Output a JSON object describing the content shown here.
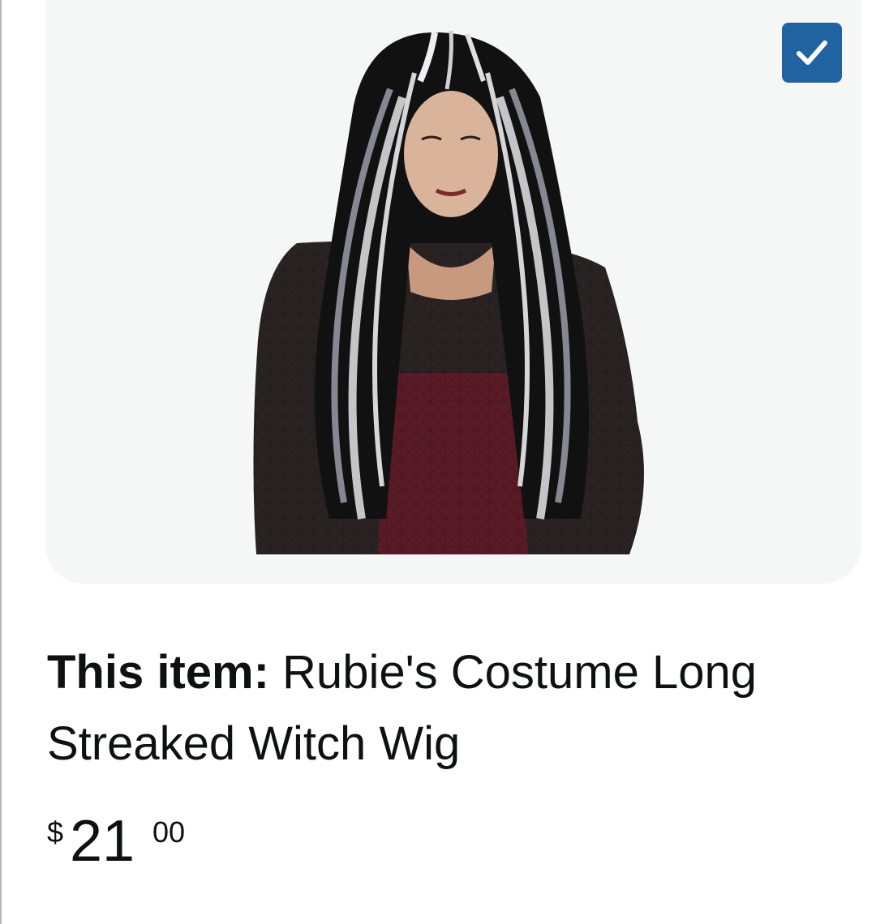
{
  "product": {
    "title_prefix": "This item:",
    "title": "Rubie's Costume Long Streaked Witch Wig",
    "price": {
      "symbol": "$",
      "whole": "21",
      "fraction": "00"
    },
    "selected": true
  },
  "icons": {
    "checkbox": "checkmark-icon"
  },
  "colors": {
    "checkbox_bg": "#2162a1",
    "card_bg": "#f5f6f6",
    "text": "#0f1111"
  }
}
